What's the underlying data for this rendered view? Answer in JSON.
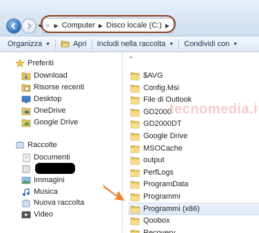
{
  "address": {
    "crumbs": [
      "Computer",
      "Disco locale (C:)"
    ]
  },
  "toolbar": {
    "organize": "Organizza",
    "open": "Apri",
    "include": "Includi nella raccolta",
    "share": "Condividi con"
  },
  "nav": {
    "favorites": {
      "header": "Preferiti",
      "items": [
        "Download",
        "Risorse recenti",
        "Desktop",
        "OneDrive",
        "Google Drive"
      ]
    },
    "libraries": {
      "header": "Raccolte",
      "items": [
        "Documenti",
        "",
        "Immagini",
        "Musica",
        "Nuova raccolta",
        "Video"
      ]
    }
  },
  "files": [
    "$AVG",
    "Config.Msi",
    "File di Outlook",
    "GD2000",
    "GD2000DT",
    "Google Drive",
    "MSOCache",
    "output",
    "PerfLogs",
    "ProgramData",
    "Programmi",
    "Programmi (x86)",
    "Qoobox",
    "Recovery"
  ],
  "selected_file": "Programmi (x86)",
  "watermark": "tecnomedia.it",
  "colors": {
    "highlight_ring": "#8a3a16",
    "arrow": "#f0812a",
    "folder": "#e8c45a"
  }
}
